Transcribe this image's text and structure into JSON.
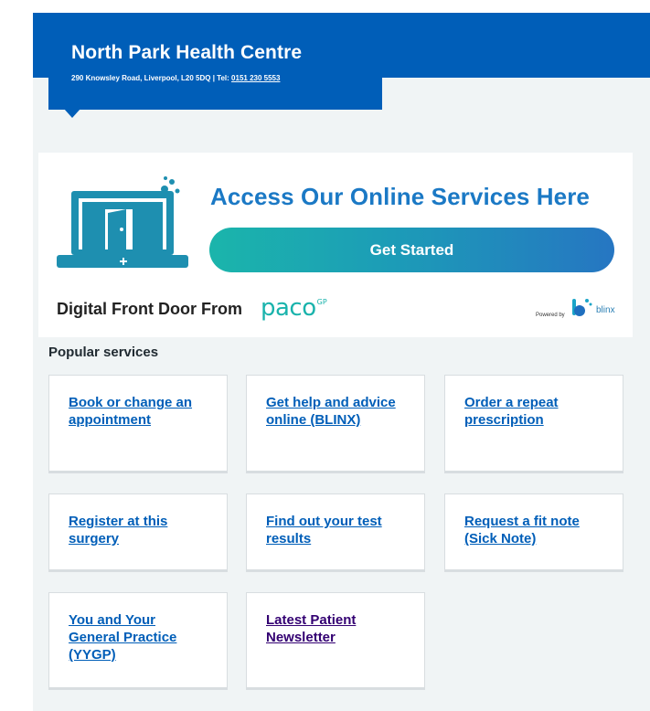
{
  "organisation": {
    "name": "North Park Health Centre",
    "address": "290 Knowsley Road, Liverpool, L20 5DQ | Tel:",
    "phone": "0151 230 5553"
  },
  "banner": {
    "heading": "Access Our Online Services Here",
    "button_label": "Get Started",
    "front_door_text": "Digital Front Door From",
    "paco_logo": "paco",
    "paco_superscript": "GP",
    "powered_by": "Powered by",
    "blinx_logo": "blinx",
    "colors": {
      "heading": "#1b79c5",
      "teal": "#1bb5ab",
      "blue": "#2676c2"
    }
  },
  "popular_services": {
    "title": "Popular services",
    "items": [
      {
        "label": "Book or change an appointment"
      },
      {
        "label": "Get help and advice online (BLINX)"
      },
      {
        "label": "Order a repeat prescription"
      },
      {
        "label": "Register at this surgery"
      },
      {
        "label": "Find out your test results"
      },
      {
        "label": "Request a fit note (Sick Note)"
      },
      {
        "label": "You and Your General Practice (YYGP)"
      },
      {
        "label": "Latest Patient Newsletter",
        "visited": true
      }
    ]
  },
  "colors": {
    "nhs_blue": "#005eb8",
    "background": "#f0f4f5",
    "visited_link": "#330072"
  }
}
